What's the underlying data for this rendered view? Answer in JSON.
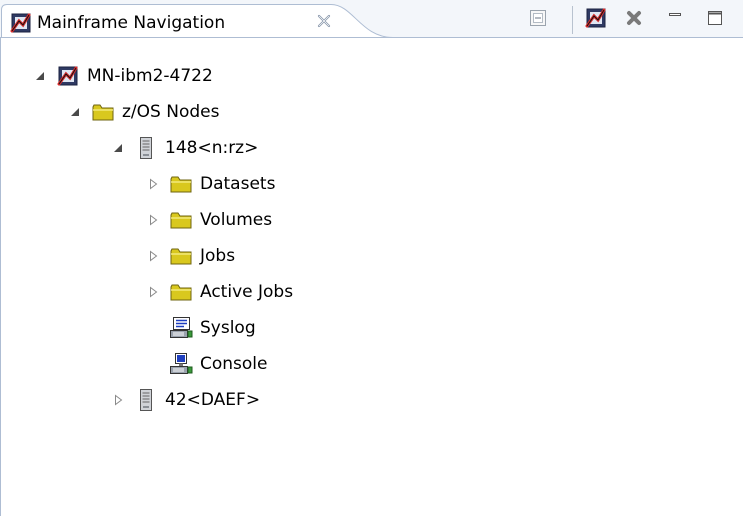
{
  "view": {
    "title": "Mainframe Navigation"
  },
  "tree": {
    "root": {
      "label": "MN-ibm2-4722",
      "expanded": true
    },
    "zos_nodes": {
      "label": "z/OS Nodes",
      "expanded": true
    },
    "node_148": {
      "label": "148<n:rz>",
      "expanded": true
    },
    "datasets": {
      "label": "Datasets",
      "expanded": false
    },
    "volumes": {
      "label": "Volumes",
      "expanded": false
    },
    "jobs": {
      "label": "Jobs",
      "expanded": false
    },
    "active_jobs": {
      "label": "Active Jobs",
      "expanded": false
    },
    "syslog": {
      "label": "Syslog"
    },
    "console": {
      "label": "Console"
    },
    "node_42": {
      "label": "42<DAEF>",
      "expanded": false
    }
  },
  "colors": {
    "folder": "#d9c81e",
    "folder_outline": "#6f6510",
    "tab_border": "#aebdd3",
    "header_bg": "#f3f6fa",
    "connect_red": "#c62828",
    "delete_gray": "#7a7a7a"
  },
  "icons": {
    "mainframe": "mainframe-connection-icon",
    "folder": "folder-icon",
    "server": "server-icon",
    "syslog": "syslog-icon",
    "console": "console-icon"
  }
}
